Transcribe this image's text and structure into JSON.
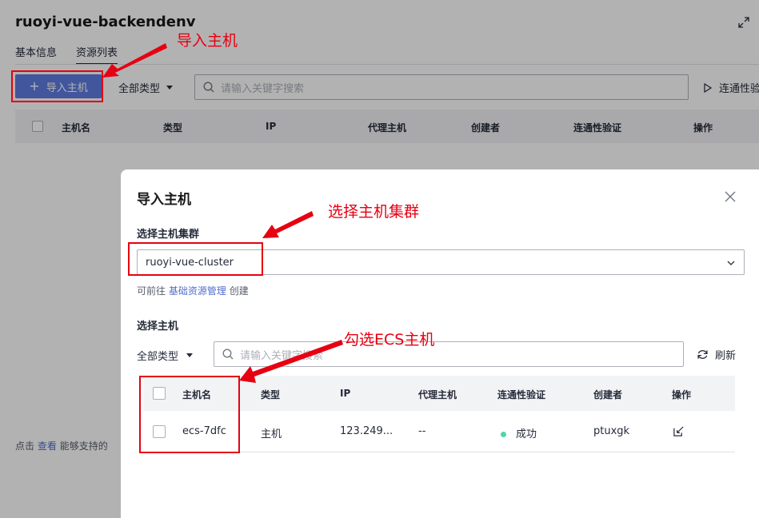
{
  "page": {
    "title": "ruoyi-vue-backendenv",
    "tabs": [
      {
        "label": "基本信息"
      },
      {
        "label": "资源列表"
      }
    ],
    "toolbar": {
      "import_button": "导入主机",
      "type_filter": "全部类型",
      "search_placeholder": "请输入关键字搜索",
      "verify_button": "连通性验"
    },
    "table_headers": [
      "主机名",
      "类型",
      "IP",
      "代理主机",
      "创建者",
      "连通性验证",
      "操作"
    ],
    "footer": {
      "prefix": "点击",
      "link": "查看",
      "suffix": "能够支持的"
    }
  },
  "modal": {
    "title": "导入主机",
    "cluster_label": "选择主机集群",
    "cluster_value": "ruoyi-vue-cluster",
    "hint_prefix": "可前往",
    "hint_link": "基础资源管理",
    "hint_suffix": "创建",
    "host_label": "选择主机",
    "type_filter": "全部类型",
    "search_placeholder": "请输入关键字搜索",
    "refresh_label": "刷新",
    "table_headers": [
      "主机名",
      "类型",
      "IP",
      "代理主机",
      "连通性验证",
      "创建者",
      "操作"
    ],
    "rows": [
      {
        "hostname": "ecs-7dfc",
        "type": "主机",
        "ip": "123.249...",
        "proxy": "--",
        "status": "成功",
        "creator": "ptuxgk"
      }
    ]
  },
  "annotations": {
    "import_host": "导入主机",
    "select_cluster": "选择主机集群",
    "check_ecs": "勾选ECS主机"
  },
  "colors": {
    "primary": "#5e7ce0",
    "annotation_red": "#e60012",
    "success": "#50d4ab",
    "link": "#526ecc"
  }
}
